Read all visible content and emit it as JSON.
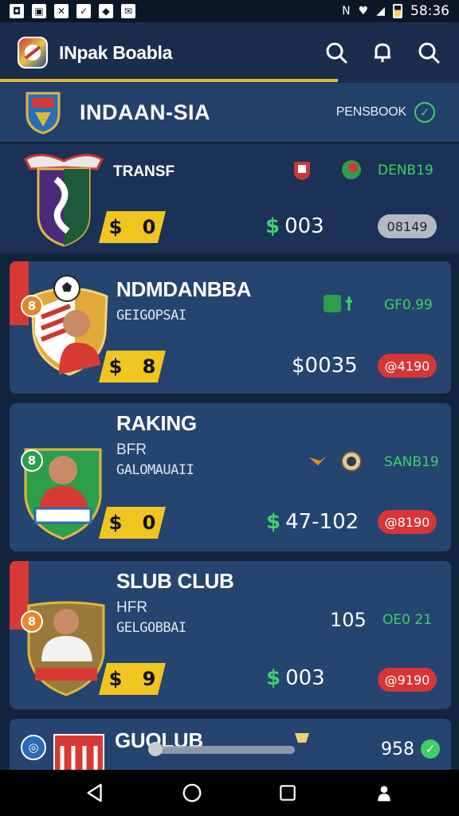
{
  "status_bar": {
    "time": "58:36",
    "left_icons": [
      "notification-icon",
      "photo-icon",
      "bolt-icon",
      "check-icon",
      "location-icon",
      "message-icon"
    ],
    "right_icons": [
      "nfc-icon",
      "wifi-icon",
      "signal-icon",
      "battery-icon"
    ]
  },
  "app_bar": {
    "title": "INpak Boabla",
    "actions": [
      "search-icon",
      "bell-icon",
      "search-icon"
    ]
  },
  "country": {
    "name": "INDAAN-SIA",
    "tag": "PENSBOOK",
    "check": "✓"
  },
  "transfer": {
    "label": "TRANSF",
    "stat": "DENB19",
    "price_symbol": "$",
    "price_digit": "0",
    "value": "003",
    "pill": "08149",
    "colors": {
      "pill": "#b4bac4"
    }
  },
  "players": [
    {
      "title": "NDMDANBBA",
      "sub": "GEIGOPSAI",
      "sub2": "",
      "rating": "8",
      "stat": "GF0.99",
      "price_symbol": "$",
      "price_digit": "8",
      "value": "$0035",
      "value_prefix": "",
      "pill": "@4190",
      "kit": "red"
    },
    {
      "title": "RAKING",
      "sub": "GALOMAUAII",
      "sub2": "BFR",
      "rating": "8",
      "stat": "SANB19",
      "price_symbol": "$",
      "price_digit": "0",
      "value": "47-102",
      "value_prefix": "$",
      "pill": "@8190",
      "kit": "red"
    },
    {
      "title": "SLUB CLUB",
      "sub": "GELGOBBAI",
      "sub2": "HFR",
      "rating": "8",
      "stat": "OE0 21",
      "stat_left": "105",
      "price_symbol": "$",
      "price_digit": "9",
      "value": "003",
      "value_prefix": "$",
      "pill": "@9190",
      "kit": "white"
    },
    {
      "title": "GUOLUB",
      "sub": "",
      "sub2": "",
      "rating": "",
      "stat": "958",
      "check": "✓"
    }
  ],
  "colors": {
    "background": "#14233d",
    "card": "#25446f",
    "accent_yellow": "#f0c51f",
    "accent_green": "#3fcf6a",
    "accent_red": "#d83535"
  },
  "nav": [
    "back-icon",
    "home-icon",
    "recents-icon",
    "profile-icon"
  ]
}
